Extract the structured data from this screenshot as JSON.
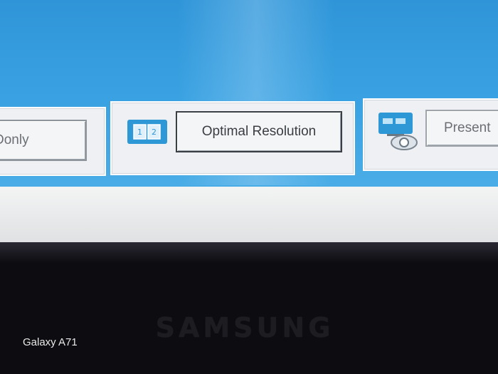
{
  "left_panel": {
    "button_label": "Donly"
  },
  "middle_panel": {
    "icon_name": "dual-monitor-icon",
    "button_label": "Optimal Resolution"
  },
  "right_panel": {
    "icon_name": "projector-display-icon",
    "button_label": "Present"
  },
  "monitor": {
    "brand": "SAMSUNG"
  },
  "photo_watermark": "Galaxy A71",
  "colors": {
    "desktop_blue": "#3aa2e2",
    "panel_bg": "#eef0f3",
    "icon_blue": "#2e97d6"
  }
}
